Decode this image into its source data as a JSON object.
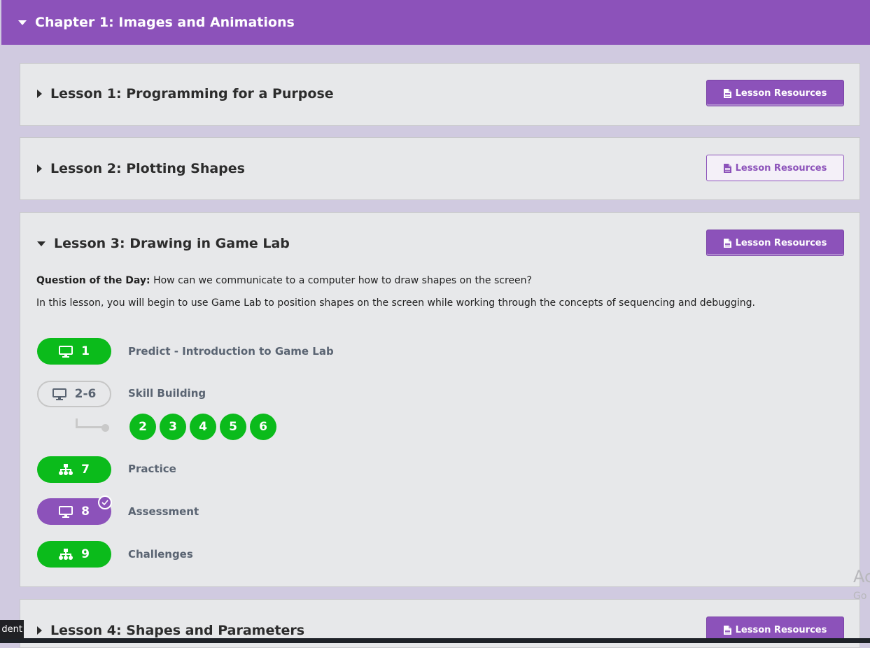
{
  "chapter": {
    "title": "Chapter 1: Images and Animations"
  },
  "lessons": [
    {
      "title": "Lesson 1: Programming for a Purpose",
      "resources_label": "Lesson Resources"
    },
    {
      "title": "Lesson 2: Plotting Shapes",
      "resources_label": "Lesson Resources"
    },
    {
      "title": "Lesson 3: Drawing in Game Lab",
      "resources_label": "Lesson Resources",
      "qotd_label": "Question of the Day:",
      "qotd_text": " How can we communicate to a computer how to draw shapes on the screen?",
      "overview": "In this lesson, you will begin to use Game Lab to position shapes on the screen while working through the concepts of sequencing and debugging.",
      "levels": [
        {
          "number": "1",
          "name": "Predict - Introduction to Game Lab",
          "icon": "desktop-icon",
          "status": "completed"
        },
        {
          "number": "2-6",
          "name": "Skill Building",
          "icon": "desktop-icon",
          "status": "group",
          "sublevels": [
            "2",
            "3",
            "4",
            "5",
            "6"
          ]
        },
        {
          "number": "7",
          "name": "Practice",
          "icon": "sitemap-icon",
          "status": "completed"
        },
        {
          "number": "8",
          "name": "Assessment",
          "icon": "desktop-icon",
          "status": "submitted"
        },
        {
          "number": "9",
          "name": "Challenges",
          "icon": "sitemap-icon",
          "status": "completed"
        }
      ]
    },
    {
      "title": "Lesson 4: Shapes and Parameters",
      "resources_label": "Lesson Resources"
    }
  ],
  "tooltip": "dent",
  "watermark": {
    "line1": "Ac",
    "line2": "Go"
  },
  "colors": {
    "purple": "#8c52ba",
    "green": "#0bbb1b",
    "background": "#d0cae0"
  }
}
